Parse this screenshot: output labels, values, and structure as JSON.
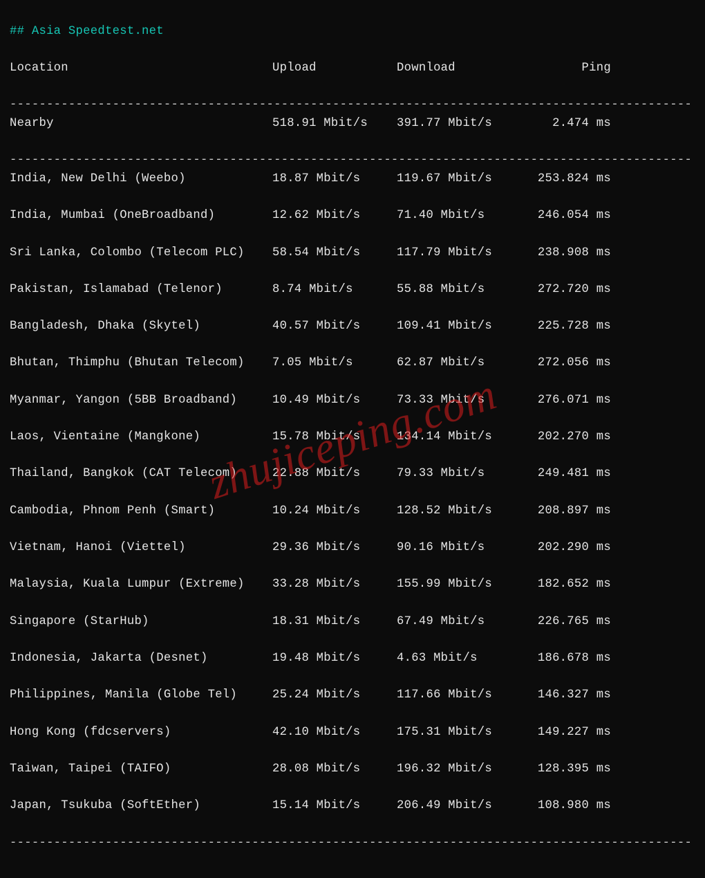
{
  "title": "## Asia Speedtest.net",
  "headers": {
    "location": "Location",
    "upload": "Upload",
    "download": "Download",
    "ping": "Ping"
  },
  "nearby": {
    "location": "Nearby",
    "upload": "518.91 Mbit/s",
    "download": "391.77 Mbit/s",
    "ping": "2.474 ms"
  },
  "rows": [
    {
      "location": "India, New Delhi (Weebo)",
      "upload": "18.87 Mbit/s",
      "download": "119.67 Mbit/s",
      "ping": "253.824 ms"
    },
    {
      "location": "India, Mumbai (OneBroadband)",
      "upload": "12.62 Mbit/s",
      "download": "71.40 Mbit/s",
      "ping": "246.054 ms"
    },
    {
      "location": "Sri Lanka, Colombo (Telecom PLC)",
      "upload": "58.54 Mbit/s",
      "download": "117.79 Mbit/s",
      "ping": "238.908 ms"
    },
    {
      "location": "Pakistan, Islamabad (Telenor)",
      "upload": "8.74 Mbit/s",
      "download": "55.88 Mbit/s",
      "ping": "272.720 ms"
    },
    {
      "location": "Bangladesh, Dhaka (Skytel)",
      "upload": "40.57 Mbit/s",
      "download": "109.41 Mbit/s",
      "ping": "225.728 ms"
    },
    {
      "location": "Bhutan, Thimphu (Bhutan Telecom)",
      "upload": "7.05 Mbit/s",
      "download": "62.87 Mbit/s",
      "ping": "272.056 ms"
    },
    {
      "location": "Myanmar, Yangon (5BB Broadband)",
      "upload": "10.49 Mbit/s",
      "download": "73.33 Mbit/s",
      "ping": "276.071 ms"
    },
    {
      "location": "Laos, Vientaine (Mangkone)",
      "upload": "15.78 Mbit/s",
      "download": "134.14 Mbit/s",
      "ping": "202.270 ms"
    },
    {
      "location": "Thailand, Bangkok (CAT Telecom)",
      "upload": "22.88 Mbit/s",
      "download": "79.33 Mbit/s",
      "ping": "249.481 ms"
    },
    {
      "location": "Cambodia, Phnom Penh (Smart)",
      "upload": "10.24 Mbit/s",
      "download": "128.52 Mbit/s",
      "ping": "208.897 ms"
    },
    {
      "location": "Vietnam, Hanoi (Viettel)",
      "upload": "29.36 Mbit/s",
      "download": "90.16 Mbit/s",
      "ping": "202.290 ms"
    },
    {
      "location": "Malaysia, Kuala Lumpur (Extreme)",
      "upload": "33.28 Mbit/s",
      "download": "155.99 Mbit/s",
      "ping": "182.652 ms"
    },
    {
      "location": "Singapore (StarHub)",
      "upload": "18.31 Mbit/s",
      "download": "67.49 Mbit/s",
      "ping": "226.765 ms"
    },
    {
      "location": "Indonesia, Jakarta (Desnet)",
      "upload": "19.48 Mbit/s",
      "download": "4.63 Mbit/s",
      "ping": "186.678 ms"
    },
    {
      "location": "Philippines, Manila (Globe Tel)",
      "upload": "25.24 Mbit/s",
      "download": "117.66 Mbit/s",
      "ping": "146.327 ms"
    },
    {
      "location": "Hong Kong (fdcservers)",
      "upload": "42.10 Mbit/s",
      "download": "175.31 Mbit/s",
      "ping": "149.227 ms"
    },
    {
      "location": "Taiwan, Taipei (TAIFO)",
      "upload": "28.08 Mbit/s",
      "download": "196.32 Mbit/s",
      "ping": "128.395 ms"
    },
    {
      "location": "Japan, Tsukuba (SoftEther)",
      "upload": "15.14 Mbit/s",
      "download": "206.49 Mbit/s",
      "ping": "108.980 ms"
    }
  ],
  "divider": "---------------------------------------------------------------------------------------------",
  "watermark": "zhujiceping.com",
  "chart_data": {
    "type": "table",
    "title": "Asia Speedtest.net",
    "columns": [
      "Location",
      "Upload",
      "Download",
      "Ping"
    ],
    "nearby": {
      "Location": "Nearby",
      "Upload": "518.91 Mbit/s",
      "Download": "391.77 Mbit/s",
      "Ping": "2.474 ms"
    },
    "rows": [
      [
        "India, New Delhi (Weebo)",
        "18.87 Mbit/s",
        "119.67 Mbit/s",
        "253.824 ms"
      ],
      [
        "India, Mumbai (OneBroadband)",
        "12.62 Mbit/s",
        "71.40 Mbit/s",
        "246.054 ms"
      ],
      [
        "Sri Lanka, Colombo (Telecom PLC)",
        "58.54 Mbit/s",
        "117.79 Mbit/s",
        "238.908 ms"
      ],
      [
        "Pakistan, Islamabad (Telenor)",
        "8.74 Mbit/s",
        "55.88 Mbit/s",
        "272.720 ms"
      ],
      [
        "Bangladesh, Dhaka (Skytel)",
        "40.57 Mbit/s",
        "109.41 Mbit/s",
        "225.728 ms"
      ],
      [
        "Bhutan, Thimphu (Bhutan Telecom)",
        "7.05 Mbit/s",
        "62.87 Mbit/s",
        "272.056 ms"
      ],
      [
        "Myanmar, Yangon (5BB Broadband)",
        "10.49 Mbit/s",
        "73.33 Mbit/s",
        "276.071 ms"
      ],
      [
        "Laos, Vientaine (Mangkone)",
        "15.78 Mbit/s",
        "134.14 Mbit/s",
        "202.270 ms"
      ],
      [
        "Thailand, Bangkok (CAT Telecom)",
        "22.88 Mbit/s",
        "79.33 Mbit/s",
        "249.481 ms"
      ],
      [
        "Cambodia, Phnom Penh (Smart)",
        "10.24 Mbit/s",
        "128.52 Mbit/s",
        "208.897 ms"
      ],
      [
        "Vietnam, Hanoi (Viettel)",
        "29.36 Mbit/s",
        "90.16 Mbit/s",
        "202.290 ms"
      ],
      [
        "Malaysia, Kuala Lumpur (Extreme)",
        "33.28 Mbit/s",
        "155.99 Mbit/s",
        "182.652 ms"
      ],
      [
        "Singapore (StarHub)",
        "18.31 Mbit/s",
        "67.49 Mbit/s",
        "226.765 ms"
      ],
      [
        "Indonesia, Jakarta (Desnet)",
        "19.48 Mbit/s",
        "4.63 Mbit/s",
        "186.678 ms"
      ],
      [
        "Philippines, Manila (Globe Tel)",
        "25.24 Mbit/s",
        "117.66 Mbit/s",
        "146.327 ms"
      ],
      [
        "Hong Kong (fdcservers)",
        "42.10 Mbit/s",
        "175.31 Mbit/s",
        "149.227 ms"
      ],
      [
        "Taiwan, Taipei (TAIFO)",
        "28.08 Mbit/s",
        "196.32 Mbit/s",
        "128.395 ms"
      ],
      [
        "Japan, Tsukuba (SoftEther)",
        "15.14 Mbit/s",
        "206.49 Mbit/s",
        "108.980 ms"
      ]
    ]
  }
}
